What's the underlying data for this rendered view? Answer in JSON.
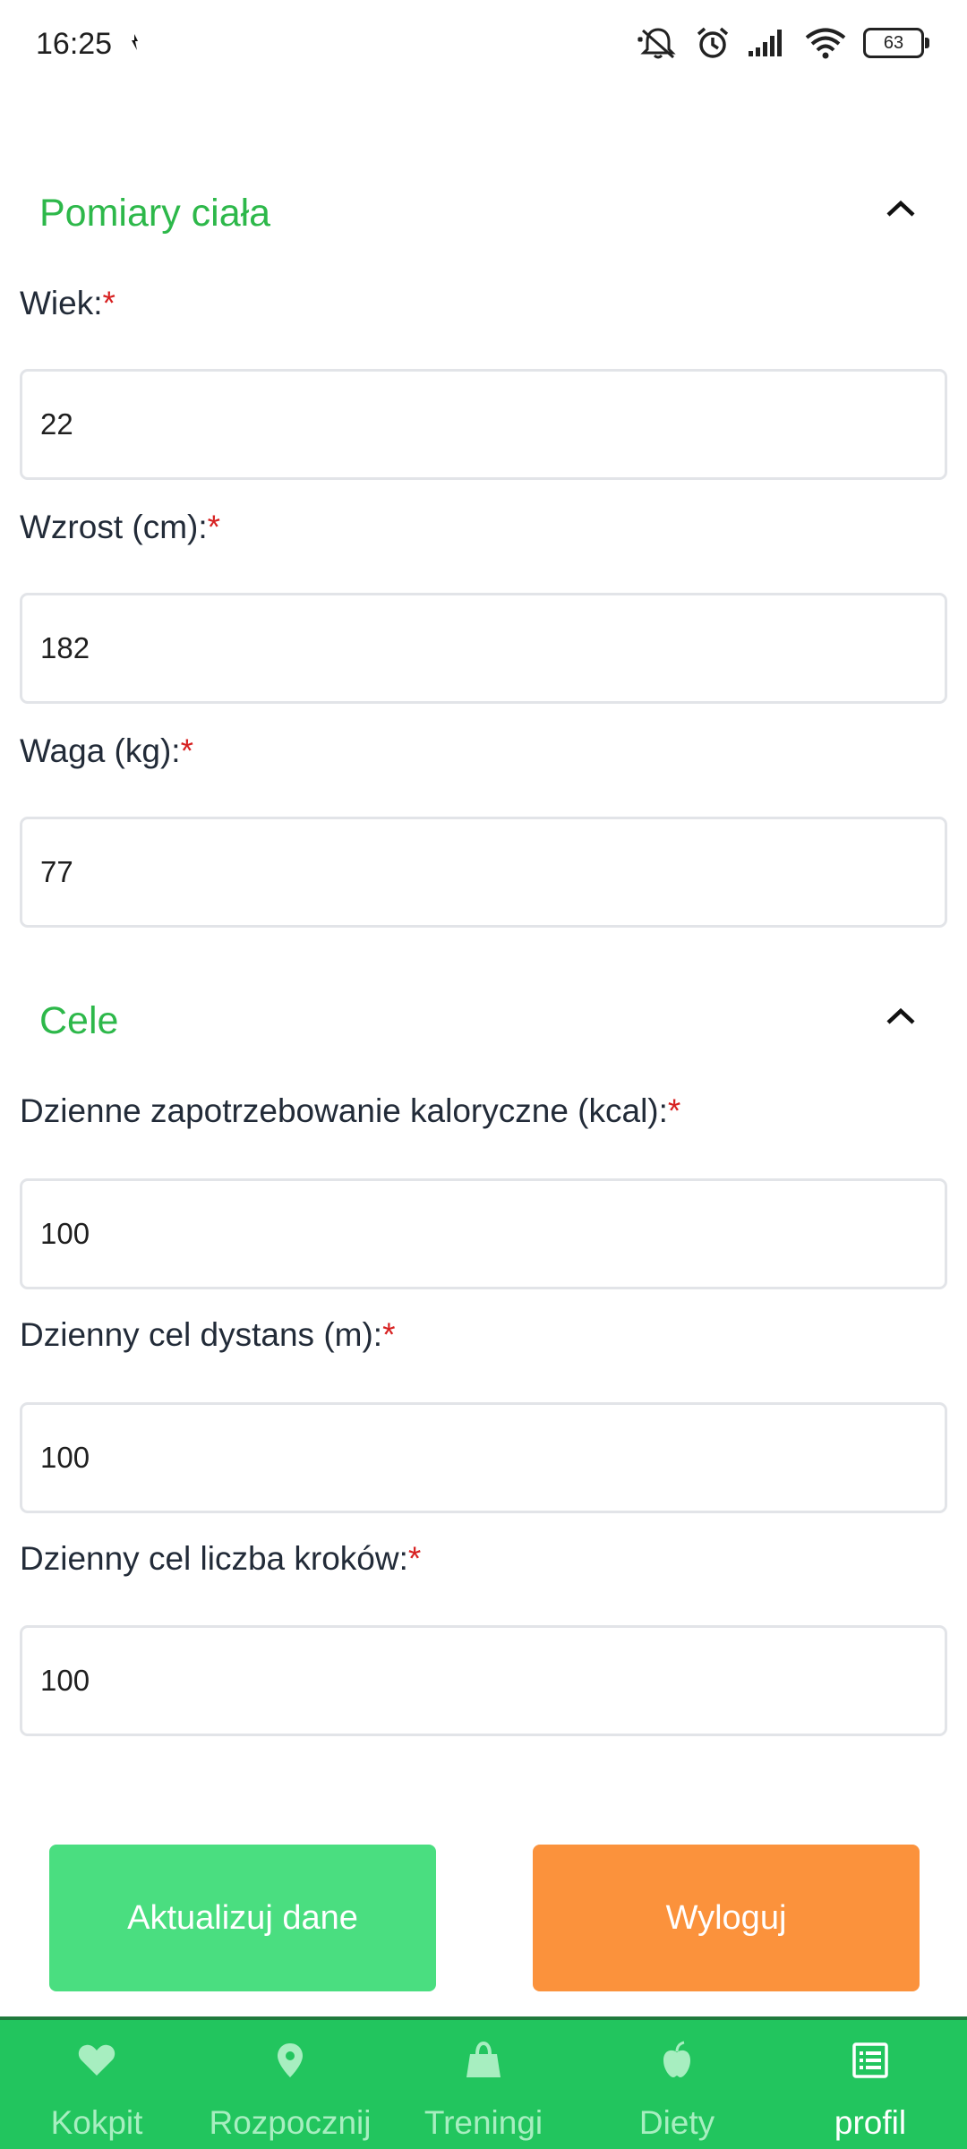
{
  "status_bar": {
    "time": "16:25",
    "battery": "63",
    "icons": [
      "notifications-muted-icon",
      "alarm-icon",
      "signal-icon",
      "wifi-icon",
      "battery-icon"
    ]
  },
  "sections": {
    "body": {
      "title": "Pomiary ciała",
      "fields": {
        "age": {
          "label": "Wiek:",
          "required": "*",
          "value": "22"
        },
        "height": {
          "label": "Wzrost (cm):",
          "required": "*",
          "value": "182"
        },
        "weight": {
          "label": "Waga (kg):",
          "required": "*",
          "value": "77"
        }
      }
    },
    "goals": {
      "title": "Cele",
      "fields": {
        "kcal": {
          "label": "Dzienne zapotrzebowanie kaloryczne (kcal):",
          "required": "*",
          "value": "100"
        },
        "distance": {
          "label": "Dzienny cel dystans (m):",
          "required": "*",
          "value": "100"
        },
        "steps": {
          "label": "Dzienny cel liczba kroków:",
          "required": "*",
          "value": "100"
        }
      }
    }
  },
  "buttons": {
    "update": "Aktualizuj dane",
    "logout": "Wyloguj"
  },
  "nav": {
    "items": [
      {
        "label": "Kokpit",
        "icon": "heart-icon"
      },
      {
        "label": "Rozpocznij",
        "icon": "map-pin-icon"
      },
      {
        "label": "Treningi",
        "icon": "bag-icon"
      },
      {
        "label": "Diety",
        "icon": "apple-icon"
      },
      {
        "label": "profil",
        "icon": "list-icon"
      }
    ],
    "active": "profil"
  },
  "colors": {
    "accent_green": "#2db84a",
    "nav_green": "#22c55e",
    "update_button": "#4ade80",
    "logout_button": "#fb923c",
    "required": "#d72121"
  }
}
